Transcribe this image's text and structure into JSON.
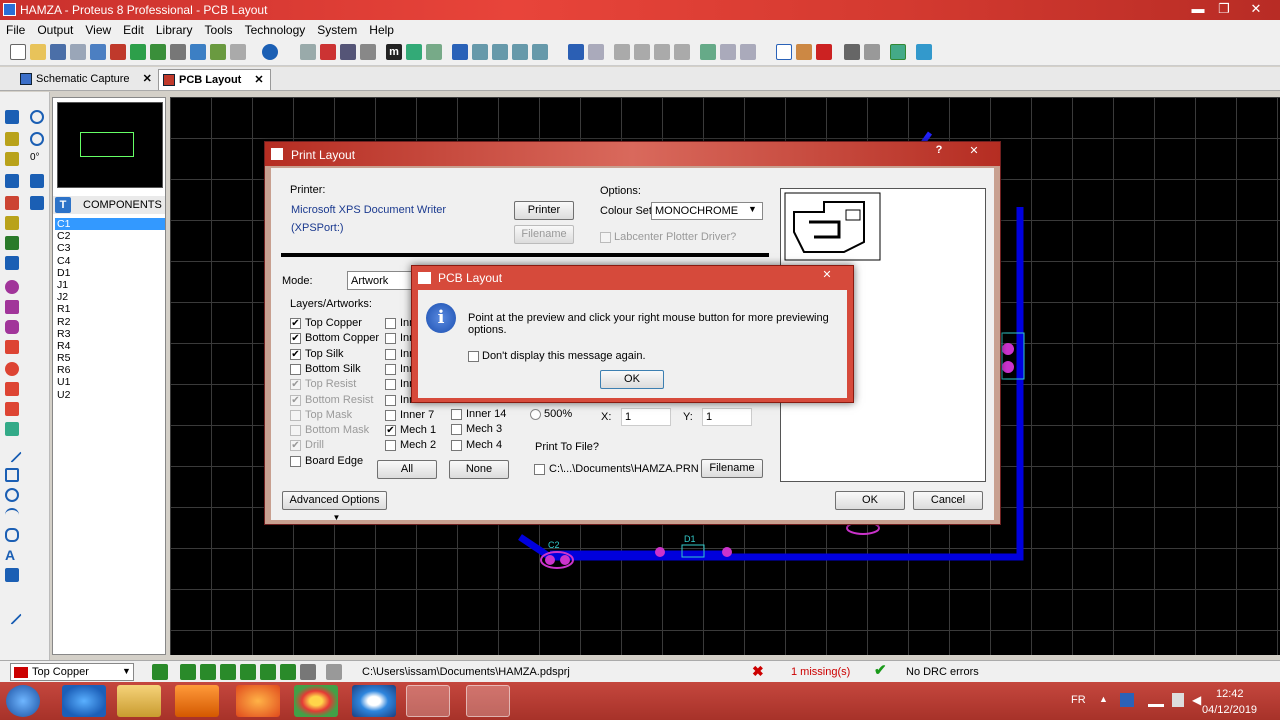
{
  "window": {
    "title": "HAMZA - Proteus 8 Professional - PCB Layout",
    "minimize": "▬",
    "maximize": "❐",
    "close": "✕"
  },
  "menu": [
    "File",
    "Output",
    "View",
    "Edit",
    "Library",
    "Tools",
    "Technology",
    "System",
    "Help"
  ],
  "tabs": [
    {
      "label": "Schematic Capture",
      "close": "✕"
    },
    {
      "label": "PCB Layout",
      "close": "✕"
    }
  ],
  "sidebar": {
    "rotation": "0°",
    "components_header": "COMPONENTS",
    "components_icon": "T",
    "components": [
      "C1",
      "C2",
      "C3",
      "C4",
      "D1",
      "J1",
      "J2",
      "R1",
      "R2",
      "R3",
      "R4",
      "R5",
      "R6",
      "U1",
      "U2"
    ],
    "selected": "C1"
  },
  "print_dialog": {
    "title": "Print Layout",
    "help": "?",
    "close": "✕",
    "printer_label": "Printer:",
    "printer_name": "Microsoft XPS Document Writer",
    "printer_port": "(XPSPort:)",
    "printer_button": "Printer",
    "filename_button": "Filename",
    "options_label": "Options:",
    "colour_set_label": "Colour Set:",
    "colour_set_value": "MONOCHROME",
    "labcenter_plotter": "Labcenter Plotter Driver?",
    "mode_label": "Mode:",
    "mode_value": "Artwork",
    "layers_label": "Layers/Artworks:",
    "layers_col1": [
      {
        "label": "Top Copper",
        "checked": true,
        "disabled": false
      },
      {
        "label": "Bottom Copper",
        "checked": true,
        "disabled": false
      },
      {
        "label": "Top Silk",
        "checked": true,
        "disabled": false
      },
      {
        "label": "Bottom Silk",
        "checked": false,
        "disabled": false
      },
      {
        "label": "Top Resist",
        "checked": true,
        "disabled": true
      },
      {
        "label": "Bottom Resist",
        "checked": true,
        "disabled": true
      },
      {
        "label": "Top Mask",
        "checked": false,
        "disabled": true
      },
      {
        "label": "Bottom Mask",
        "checked": false,
        "disabled": true
      },
      {
        "label": "Drill",
        "checked": true,
        "disabled": true
      },
      {
        "label": "Board Edge",
        "checked": false,
        "disabled": false
      }
    ],
    "layers_col2": [
      {
        "label": "Inn",
        "checked": false
      },
      {
        "label": "Inn",
        "checked": false
      },
      {
        "label": "Inn",
        "checked": false
      },
      {
        "label": "Inn",
        "checked": false
      },
      {
        "label": "Inn",
        "checked": false
      },
      {
        "label": "Inn",
        "checked": false
      },
      {
        "label": "Inner 7",
        "checked": false
      },
      {
        "label": "Mech 1",
        "checked": true
      },
      {
        "label": "Mech 2",
        "checked": false
      }
    ],
    "layers_col3": [
      {
        "label": "Inner 14",
        "checked": false
      },
      {
        "label": "Mech 3",
        "checked": false
      },
      {
        "label": "Mech 4",
        "checked": false
      }
    ],
    "all_button": "All",
    "none_button": "None",
    "scale_500": "500%",
    "x_label": "X:",
    "x_value": "1",
    "y_label": "Y:",
    "y_value": "1",
    "print_to_file_label": "Print To File?",
    "print_file_path": "C:\\...\\Documents\\HAMZA.PRN",
    "print_filename_button": "Filename",
    "advanced_options": "Advanced Options",
    "ok": "OK",
    "cancel": "Cancel"
  },
  "message_dialog": {
    "title": "PCB Layout",
    "close": "✕",
    "message": "Point at the preview and click your right mouse button for more previewing options.",
    "dont_display": "Don't display this message again.",
    "ok": "OK"
  },
  "statusbar": {
    "layer": "Top Copper",
    "layer_color": "#cc0000",
    "path": "C:\\Users\\issam\\Documents\\HAMZA.pdsprj",
    "missing": "1 missing(s)",
    "drc": "No DRC errors"
  },
  "canvas_labels": {
    "c2": "C2",
    "d1": "D1"
  },
  "taskbar": {
    "lang": "FR",
    "time": "12:42",
    "date": "04/12/2019"
  }
}
